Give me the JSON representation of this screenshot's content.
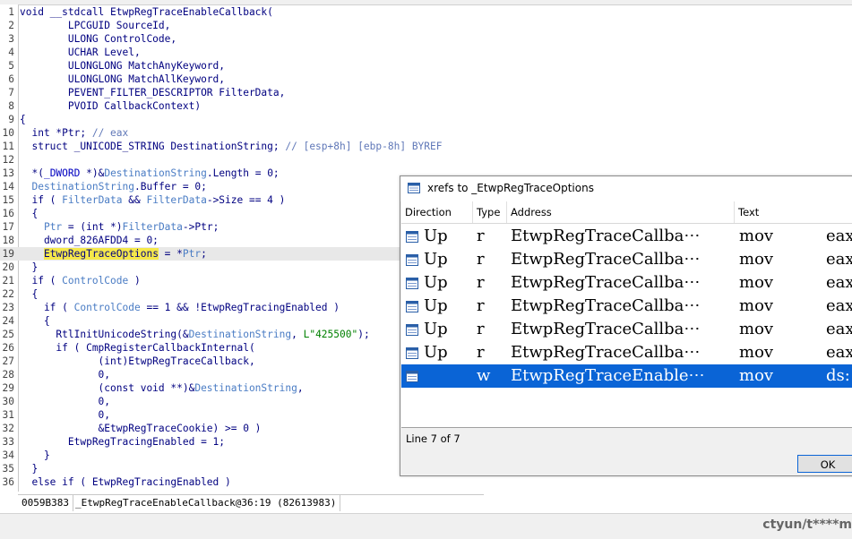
{
  "code_lines": [
    {
      "n": "1",
      "html": "void __stdcall EtwpRegTraceEnableCallback("
    },
    {
      "n": "2",
      "html": "        LPCGUID SourceId,"
    },
    {
      "n": "3",
      "html": "        ULONG ControlCode,"
    },
    {
      "n": "4",
      "html": "        UCHAR Level,"
    },
    {
      "n": "5",
      "html": "        ULONGLONG MatchAnyKeyword,"
    },
    {
      "n": "6",
      "html": "        ULONGLONG MatchAllKeyword,"
    },
    {
      "n": "7",
      "html": "        PEVENT_FILTER_DESCRIPTOR FilterData,"
    },
    {
      "n": "8",
      "html": "        PVOID CallbackContext)"
    },
    {
      "n": "9",
      "html": "{"
    },
    {
      "n": "10",
      "html": "  int *Ptr; <span class='cm'>// eax</span>"
    },
    {
      "n": "11",
      "html": "  struct _UNICODE_STRING DestinationString; <span class='cm'>// [esp+8h] [ebp-8h] BYREF</span>"
    },
    {
      "n": "12",
      "html": ""
    },
    {
      "n": "13",
      "html": "  *(<span class='c'>_DWORD</span> *)&amp;<span class='v'>DestinationString</span>.Length = 0;"
    },
    {
      "n": "14",
      "html": "  <span class='v'>DestinationString</span>.Buffer = 0;"
    },
    {
      "n": "15",
      "html": "  if ( <span class='v'>FilterData</span> &amp;&amp; <span class='v'>FilterData</span>-&gt;Size == 4 )"
    },
    {
      "n": "16",
      "html": "  {"
    },
    {
      "n": "17",
      "html": "    <span class='v'>Ptr</span> = (int *)<span class='v'>FilterData</span>-&gt;Ptr;"
    },
    {
      "n": "18",
      "html": "    dword_826AFDD4 = 0;"
    },
    {
      "n": "19",
      "html": "    <span class='hlw'>EtwpRegTraceOptions</span> = *<span class='v'>Ptr</span>;",
      "hl": true
    },
    {
      "n": "20",
      "html": "  }"
    },
    {
      "n": "21",
      "html": "  if ( <span class='v'>ControlCode</span> )"
    },
    {
      "n": "22",
      "html": "  {"
    },
    {
      "n": "23",
      "html": "    if ( <span class='v'>ControlCode</span> == 1 &amp;&amp; !EtwpRegTracingEnabled )"
    },
    {
      "n": "24",
      "html": "    {"
    },
    {
      "n": "25",
      "html": "      RtlInitUnicodeString(&amp;<span class='v'>DestinationString</span>, <span class='str'>L\"425500\"</span>);"
    },
    {
      "n": "26",
      "html": "      if ( CmpRegisterCallbackInternal("
    },
    {
      "n": "27",
      "html": "             (int)EtwpRegTraceCallback,"
    },
    {
      "n": "28",
      "html": "             0,"
    },
    {
      "n": "29",
      "html": "             (const void **)&amp;<span class='v'>DestinationString</span>,"
    },
    {
      "n": "30",
      "html": "             0,"
    },
    {
      "n": "31",
      "html": "             0,"
    },
    {
      "n": "32",
      "html": "             &amp;EtwpRegTraceCookie) &gt;= 0 )"
    },
    {
      "n": "33",
      "html": "        EtwpRegTracingEnabled = 1;"
    },
    {
      "n": "34",
      "html": "    }"
    },
    {
      "n": "35",
      "html": "  }"
    },
    {
      "n": "36",
      "html": "  else if ( EtwpRegTracingEnabled )"
    }
  ],
  "status": {
    "address": "0059B383",
    "location": "_EtwpRegTraceEnableCallback@36:19 (82613983)"
  },
  "dialog": {
    "title": "xrefs to _EtwpRegTraceOptions",
    "columns": [
      "Direction",
      "Type",
      "Address",
      "Text"
    ],
    "rows": [
      {
        "direction": "Up",
        "type": "r",
        "address": "EtwpRegTraceCallba⋯",
        "text": "mov",
        "operand": "eax"
      },
      {
        "direction": "Up",
        "type": "r",
        "address": "EtwpRegTraceCallba⋯",
        "text": "mov",
        "operand": "eax"
      },
      {
        "direction": "Up",
        "type": "r",
        "address": "EtwpRegTraceCallba⋯",
        "text": "mov",
        "operand": "eax"
      },
      {
        "direction": "Up",
        "type": "r",
        "address": "EtwpRegTraceCallba⋯",
        "text": "mov",
        "operand": "eax"
      },
      {
        "direction": "Up",
        "type": "r",
        "address": "EtwpRegTraceCallba⋯",
        "text": "mov",
        "operand": "eax"
      },
      {
        "direction": "Up",
        "type": "r",
        "address": "EtwpRegTraceCallba⋯",
        "text": "mov",
        "operand": "eax"
      },
      {
        "direction": "",
        "type": "w",
        "address": "EtwpRegTraceEnable⋯",
        "text": "mov",
        "operand": "ds:",
        "selected": true
      }
    ],
    "footer": "Line 7 of 7",
    "ok_label": "OK"
  },
  "watermark": "ctyun/t****m",
  "colors": {
    "selection": "#0a64d6",
    "highlight": "#f5e84a"
  }
}
